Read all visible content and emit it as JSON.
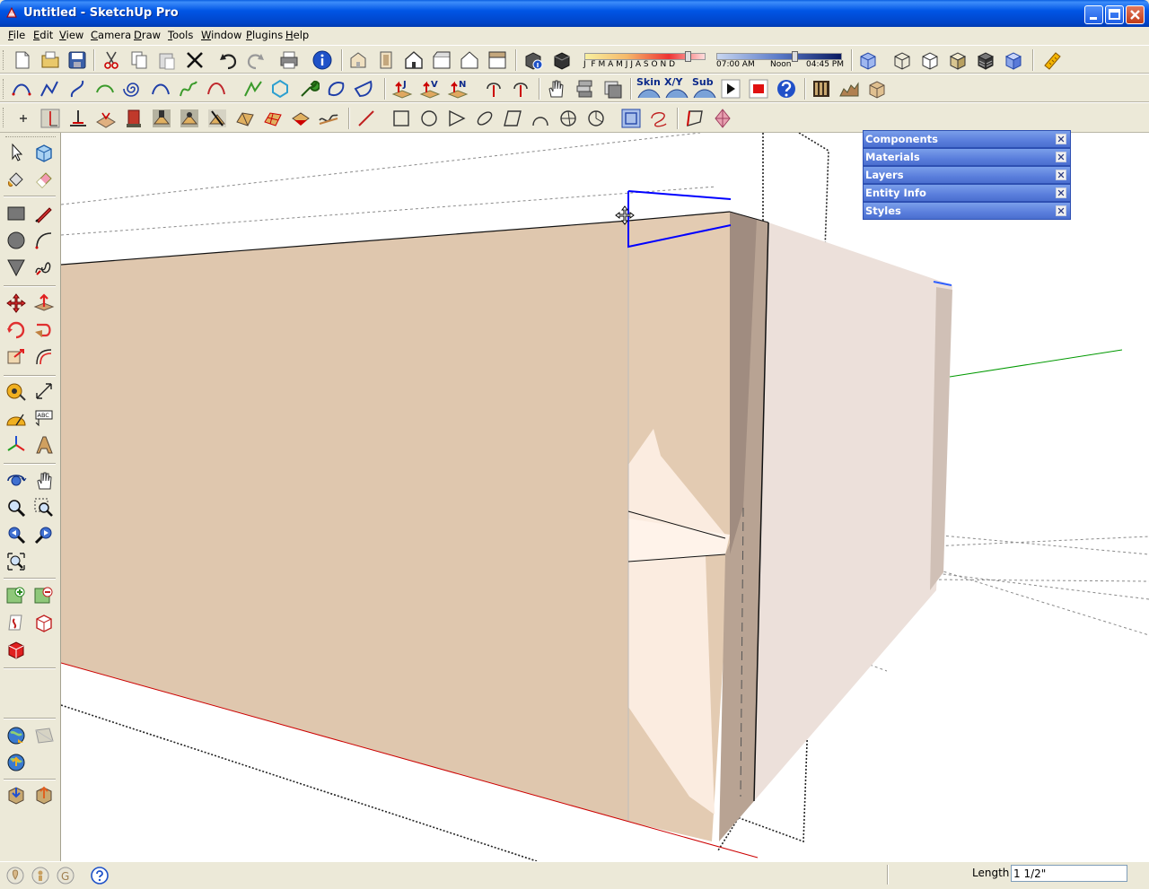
{
  "window": {
    "title": "Untitled - SketchUp Pro",
    "controls": [
      "minimize",
      "maximize",
      "close"
    ]
  },
  "menu": [
    "File",
    "Edit",
    "View",
    "Camera",
    "Draw",
    "Tools",
    "Window",
    "Plugins",
    "Help"
  ],
  "shadows": {
    "months": [
      "J",
      "F",
      "M",
      "A",
      "M",
      "J",
      "J",
      "A",
      "S",
      "O",
      "N",
      "D"
    ],
    "time_start": "07:00 AM",
    "time_mid": "Noon",
    "time_end": "04:45 PM"
  },
  "plugin_buttons": [
    "Skin",
    "X/Y",
    "Sub"
  ],
  "toolbar_letters": [
    "J",
    "V",
    "N"
  ],
  "dialogs": [
    "Components",
    "Materials",
    "Layers",
    "Entity Info",
    "Styles"
  ],
  "status": {
    "length_label": "Length",
    "length_value": "1 1/2\""
  },
  "colors": {
    "title_bar": "#0054e3",
    "dialog_header": "#5a7edc",
    "face_front": "#dfc8b0",
    "face_side": "#ede0da",
    "red_axis": "#cc0000",
    "green_axis": "#009900",
    "selection_blue": "#0000ff"
  }
}
